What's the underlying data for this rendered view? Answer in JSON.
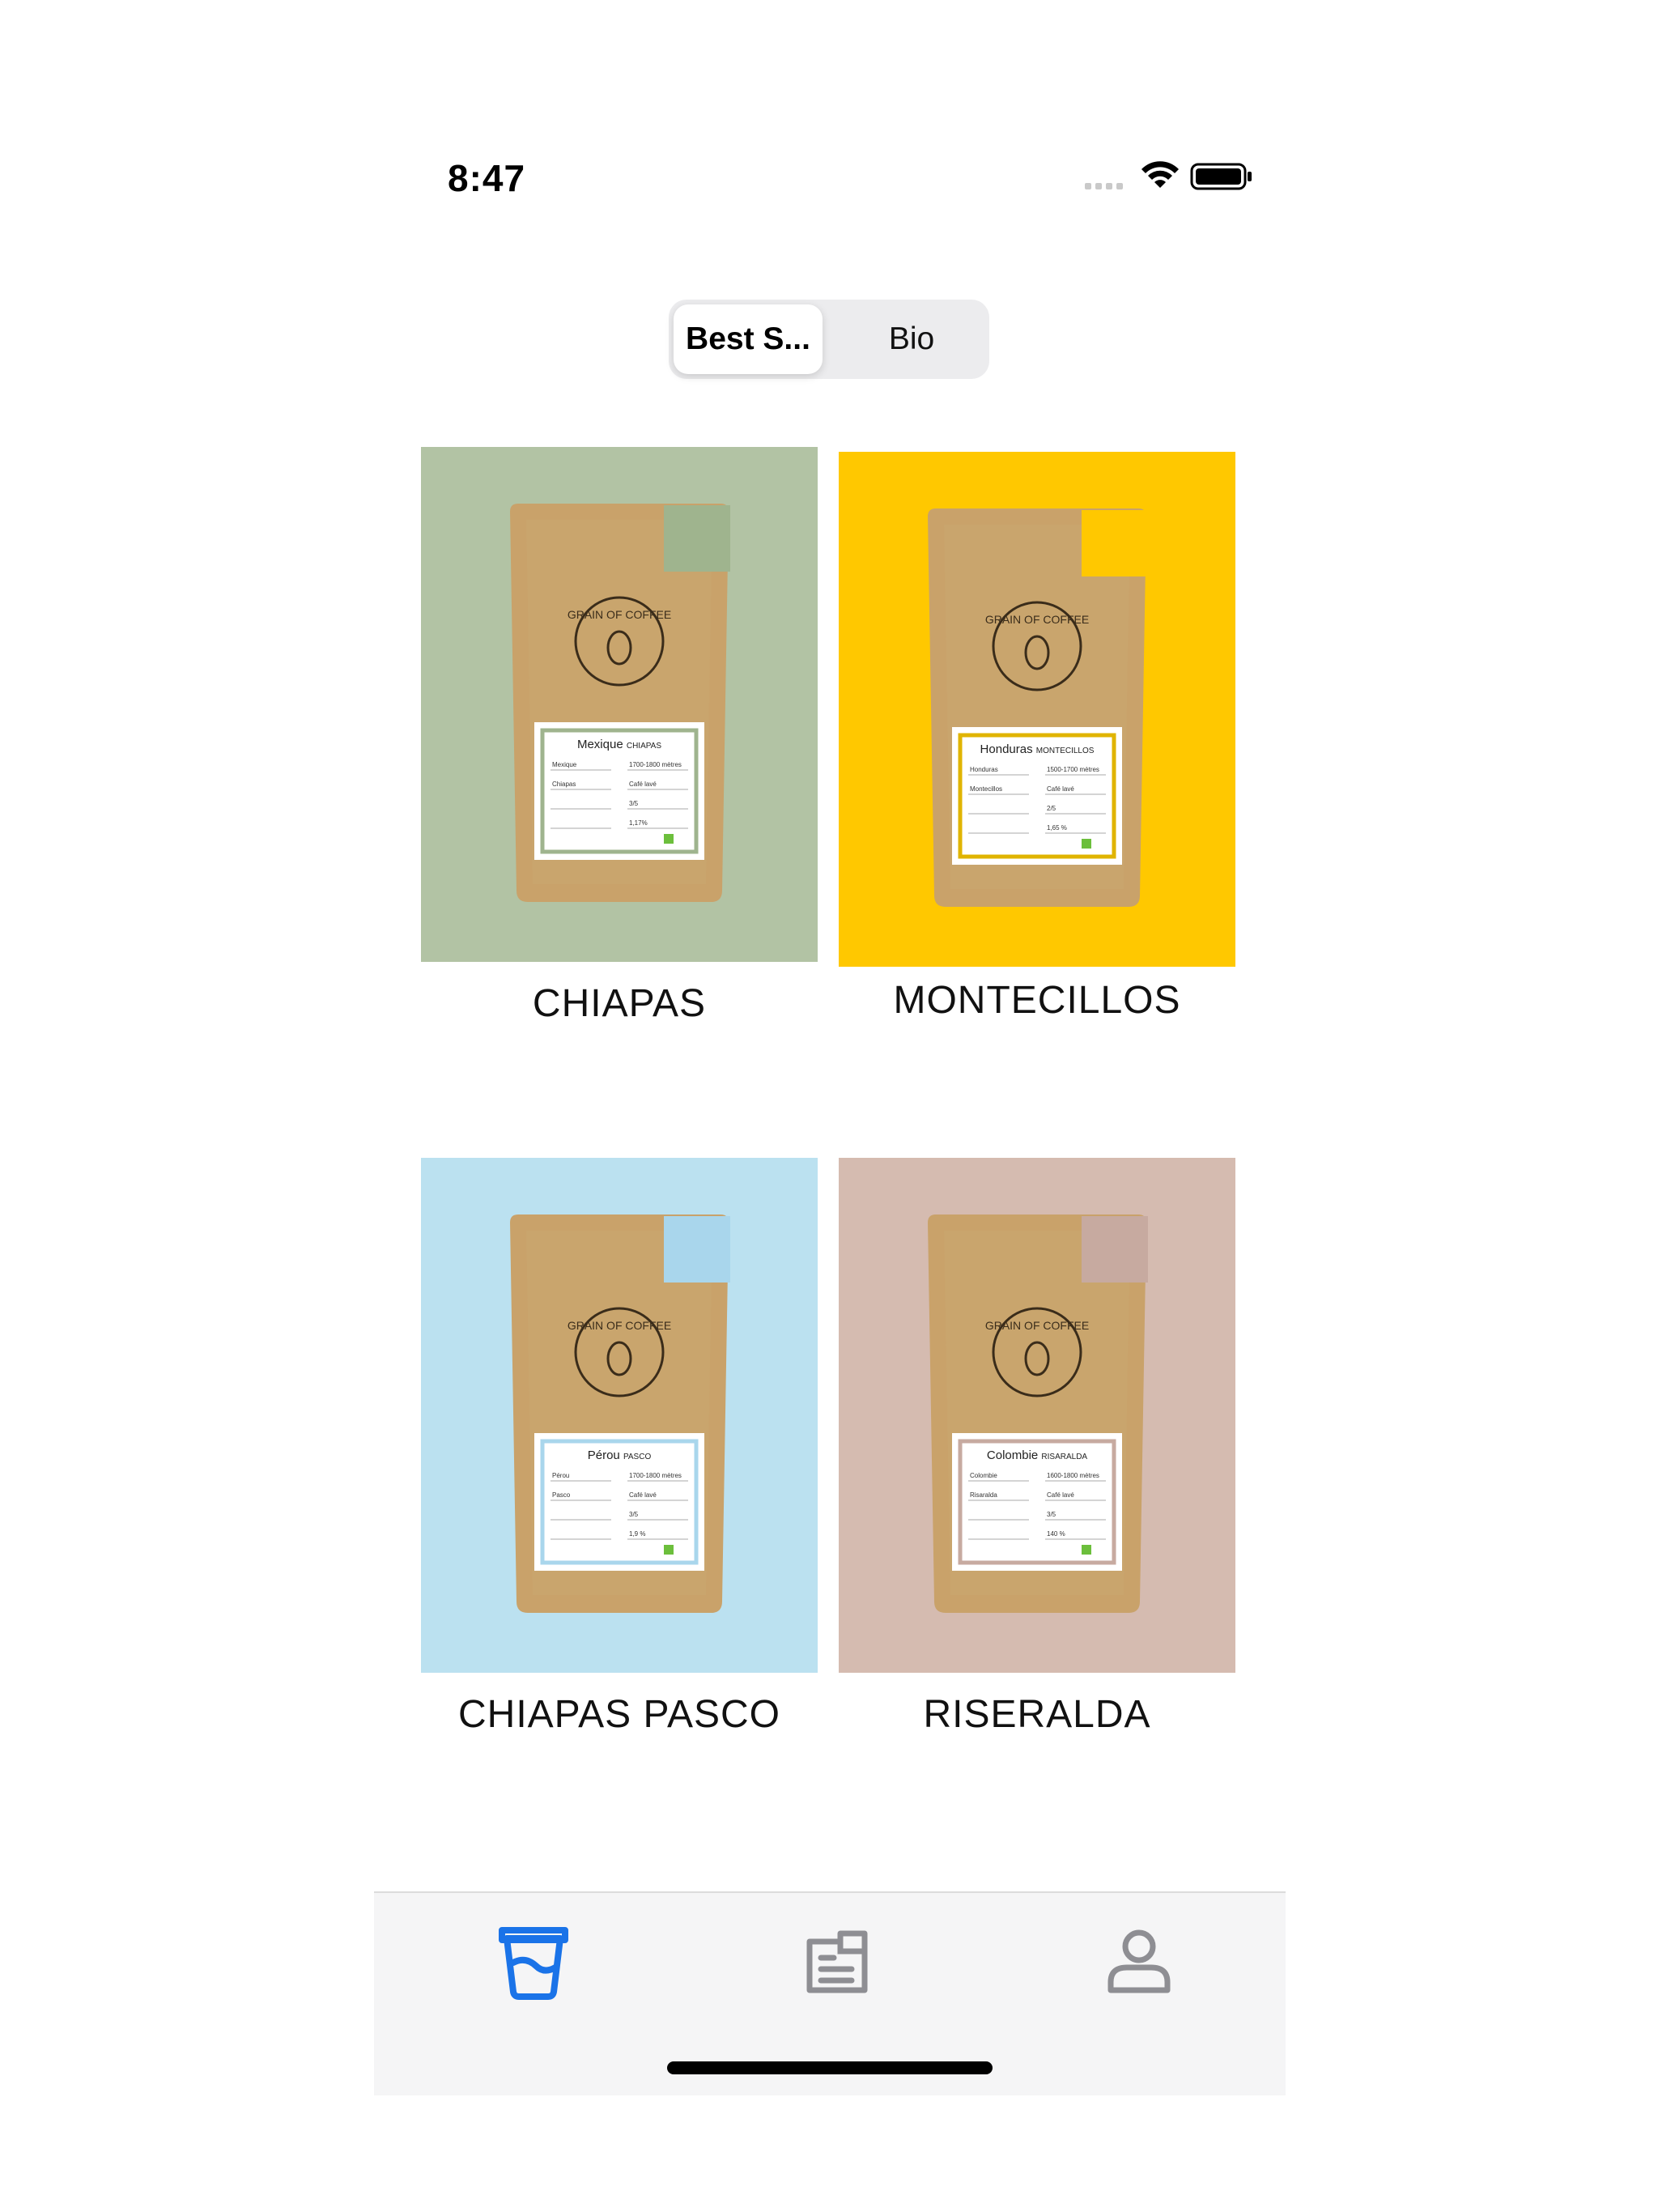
{
  "status_bar": {
    "time": "8:47",
    "icons": [
      "signal-icon",
      "wifi-icon",
      "battery-icon"
    ]
  },
  "segmented_control": {
    "segments": [
      "Best S...",
      "Bio"
    ],
    "selected": "Best S..."
  },
  "products": [
    {
      "name": "CHIAPAS",
      "background": "#b2c3a4",
      "accent": "#9fb48e",
      "label": {
        "title": "Mexique",
        "subtitle": "CHIAPAS",
        "pays": "Mexique",
        "region": "Chiapas",
        "altitude": "1700-1800 mètres",
        "process": "Café lavé",
        "intensite": "3/5",
        "cafeine": "1,17%"
      }
    },
    {
      "name": "MONTECILLOS",
      "background": "#ffc800",
      "accent": "#ffc800",
      "label": {
        "title": "Honduras",
        "subtitle": "MONTECILLOS",
        "pays": "Honduras",
        "region": "Montecillos",
        "altitude": "1500-1700 mètres",
        "process": "Café lavé",
        "intensite": "2/5",
        "cafeine": "1,65 %"
      }
    },
    {
      "name": "CHIAPAS PASCO",
      "background": "#bbe1f0",
      "accent": "#a9d6ec",
      "label": {
        "title": "Pérou",
        "subtitle": "PASCO",
        "pays": "Pérou",
        "region": "Pasco",
        "altitude": "1700-1800 mètres",
        "process": "Café lavé",
        "intensite": "3/5",
        "cafeine": "1,9 %"
      }
    },
    {
      "name": "RISERALDA",
      "background": "#d5bbb0",
      "accent": "#c7aaa0",
      "label": {
        "title": "Colombie",
        "subtitle": "RISARALDA",
        "pays": "Colombie",
        "region": "Risaralda",
        "altitude": "1600-1800 mètres",
        "process": "Café lavé",
        "intensite": "3/5",
        "cafeine": "140 %"
      }
    }
  ],
  "bag_brand": "GRAIN OF COFFEE",
  "tab_bar": {
    "tabs": [
      {
        "icon": "coffee-cup-icon",
        "active": true
      },
      {
        "icon": "order-list-icon",
        "active": false
      },
      {
        "icon": "profile-icon",
        "active": false
      }
    ],
    "active_color": "#1a73e8",
    "inactive_color": "#8e8e93"
  }
}
